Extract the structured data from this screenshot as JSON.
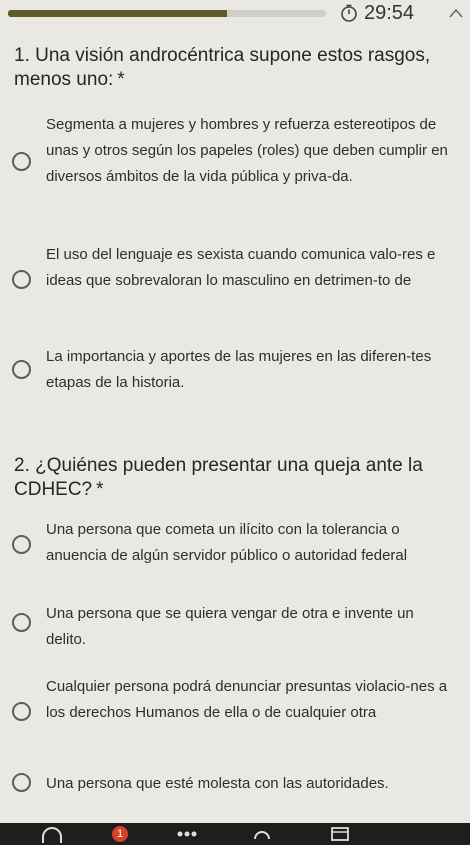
{
  "timer": {
    "value": "29:54",
    "icon": "timer-icon"
  },
  "progress": {
    "fraction": 0.69,
    "color": "#5f5c2a"
  },
  "questions": [
    {
      "number": "1.",
      "text": "Una visión androcéntrica supone estos rasgos, menos uno:",
      "required_mark": "*",
      "options": [
        "Segmenta a mujeres y hombres y refuerza estereotipos de unas y otros según los papeles (roles) que deben cumplir en diversos ámbitos de la vida pública y priva-da.",
        "El uso del lenguaje es sexista cuando comunica valo-res e ideas que sobrevaloran lo masculino en detrimen-to de",
        "La importancia y aportes de las mujeres en las diferen-tes etapas de la historia."
      ]
    },
    {
      "number": "2.",
      "text": "¿Quiénes pueden presentar una queja ante la CDHEC?",
      "required_mark": "*",
      "options": [
        "Una persona que cometa un ilícito con la tolerancia o anuencia de algún servidor público o autoridad federal",
        "Una persona que se quiera vengar de otra e invente un delito.",
        "Cualquier persona podrá denunciar presuntas violacio-nes a los derechos Humanos de ella o de cualquier otra",
        "Una persona que esté molesta con las autoridades."
      ]
    }
  ],
  "bottom_bar": {
    "notification_badge": "1",
    "icons": [
      "headphones-icon",
      "notification-badge-icon",
      "dots-icon",
      "triangle-icon",
      "window-icon"
    ]
  }
}
